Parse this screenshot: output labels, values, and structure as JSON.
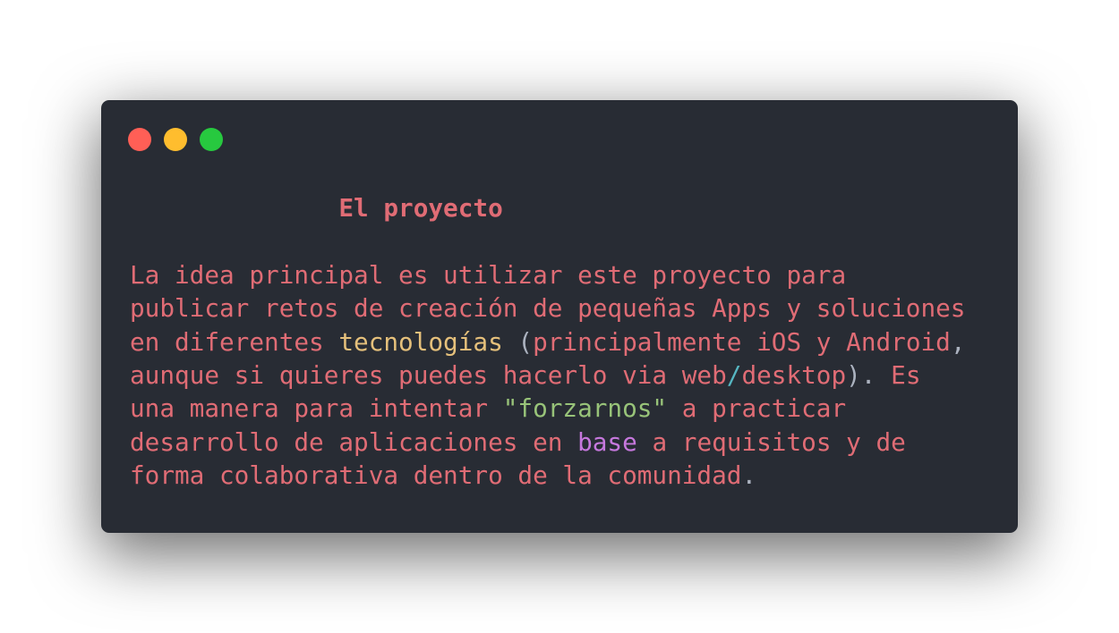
{
  "window": {
    "controls": {
      "close_color": "#ff5f56",
      "minimize_color": "#ffbd2e",
      "maximize_color": "#27c93f"
    }
  },
  "content": {
    "heading": "El proyecto",
    "paragraph": {
      "line1": "La idea principal es utilizar este proyecto para",
      "line2": "publicar retos de creación de pequeñas Apps y soluciones",
      "line3_a": "en diferentes ",
      "line3_b": "tecnologías",
      "line3_c": " (",
      "line3_d": "principalmente iOS y Android",
      "line3_e": ",",
      "line4_a": "aunque si quieres puedes hacerlo via web",
      "line4_b": "/",
      "line4_c": "desktop",
      "line4_d": ").",
      "line4_e": " Es",
      "line5_a": "una manera para intentar ",
      "line5_b": "\"forzarnos\"",
      "line5_c": " a practicar",
      "line6_a": "desarrollo de aplicaciones en ",
      "line6_b": "base",
      "line6_c": " a requisitos y de",
      "line7_a": "forma colaborativa dentro de la comunidad",
      "line7_b": "."
    },
    "colors": {
      "background": "#282c34",
      "text": "#e06c75",
      "emphasis": "#e5c07b",
      "string": "#98c379",
      "keyword": "#c678dd",
      "operator": "#56b6c2",
      "punctuation": "#abb2bf"
    }
  }
}
